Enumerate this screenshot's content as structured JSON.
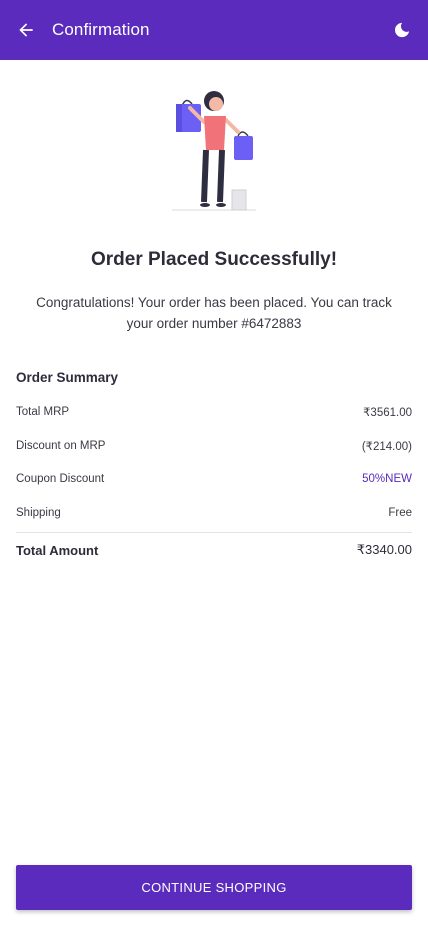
{
  "appbar": {
    "title": "Confirmation",
    "back_icon": "arrow-back-icon",
    "theme_icon": "moon-icon",
    "color": "#5a2bbd"
  },
  "confirmation": {
    "headline": "Order Placed Successfully!",
    "message": "Congratulations! Your order has been placed. You can track your order number #6472883"
  },
  "order_summary": {
    "heading": "Order Summary",
    "rows": [
      {
        "label": "Total MRP",
        "value": "₹3561.00"
      },
      {
        "label": "Discount on MRP",
        "value": "(₹214.00)"
      },
      {
        "label": "Coupon Discount",
        "value": "50%NEW"
      },
      {
        "label": "Shipping",
        "value": "Free"
      }
    ],
    "total": {
      "label": "Total Amount",
      "value": "₹3340.00"
    }
  },
  "cta": {
    "label": "CONTINUE SHOPPING"
  }
}
